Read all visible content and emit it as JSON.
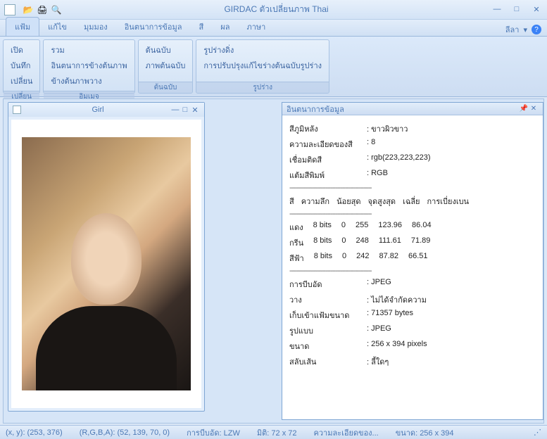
{
  "app": {
    "title": "GIRDAC ตัวเปลี่ยนภาพ Thai"
  },
  "qat": {
    "open": "📂",
    "print": "🖨",
    "preview": "🔍"
  },
  "tabs": [
    "แฟ้ม",
    "แก้ไข",
    "มุมมอง",
    "อินตนาการข้อมูล",
    "สี",
    "ผล",
    "ภาษา"
  ],
  "styleMenu": "ลีลา",
  "ribbon": {
    "group1": {
      "label": "เปลี่ยน",
      "items": [
        "เปิด",
        "บันทึก",
        "เปลี่ยน"
      ]
    },
    "group2": {
      "label": "อิมเมจ",
      "items": [
        "รวม",
        "อินตนาการข้างต้นภาพ",
        "ข้างต้นภาพวาง"
      ]
    },
    "group3": {
      "label": "ต้นฉบับ",
      "items": [
        "ต้นฉบับ",
        "ภาพต้นฉบับ"
      ]
    },
    "group4": {
      "label": "รูปร่าง",
      "items": [
        "รูปร่างดิ่ง",
        "การปรับปรุงแก้ไขร่างต้นฉบับรูปร่าง"
      ]
    }
  },
  "doc": {
    "title": "Girl"
  },
  "panel": {
    "title": "อินตนาการข้อมูล",
    "props1": [
      {
        "label": "สีภูมิหลัง",
        "value": ": ขาวผิวขาว"
      },
      {
        "label": "ความละเอียดของสี",
        "value": ": 8"
      },
      {
        "label": "เชื่อมติดสี",
        "value": ": rgb(223,223,223)"
      },
      {
        "label": "แต้มสีพิมพ์",
        "value": ": RGB"
      }
    ],
    "sep": "--------------------------------------------------",
    "tableHead": [
      "สี",
      "ความลึก",
      "น้อยสุด",
      "จุดสูงสุด",
      "เฉลี่ย",
      "การเบี่ยงเบน"
    ],
    "tableRows": [
      [
        "แดง",
        "8 bits",
        "0",
        "255",
        "123.96",
        "86.04"
      ],
      [
        "กรีน",
        "8 bits",
        "0",
        "248",
        "111.61",
        "71.89"
      ],
      [
        "สีฟ้า",
        "8 bits",
        "0",
        "242",
        "87.82",
        "66.51"
      ]
    ],
    "props2": [
      {
        "label": "การบีบอัด",
        "value": ": JPEG"
      },
      {
        "label": "วาง",
        "value": ": ไม่ได้จำกัดความ"
      },
      {
        "label": "เก็บเข้าแฟ้มขนาด",
        "value": ": 71357 bytes"
      },
      {
        "label": "รูปแบบ",
        "value": ": JPEG"
      },
      {
        "label": "ขนาด",
        "value": ": 256 x 394 pixels"
      },
      {
        "label": "สลับเส้น",
        "value": ": ลี้ใดๆ"
      }
    ]
  },
  "status": {
    "xy": "(x, y): (253, 376)",
    "rgba": "(R,G,B,A): (52, 139, 70, 0)",
    "comp": "การบีบอัด: LZW",
    "dim": "มิติ: 72 x 72",
    "depth": "ความละเอียดของ...",
    "size": "ขนาด: 256 x 394"
  }
}
